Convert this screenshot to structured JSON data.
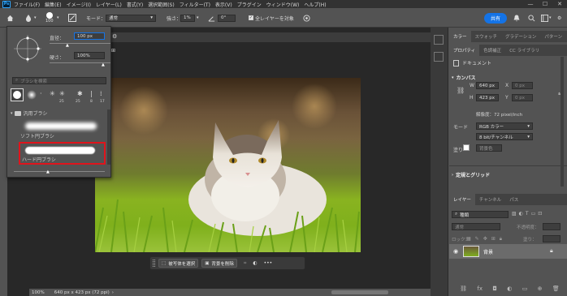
{
  "menubar": {
    "app_icon": "Ps",
    "items": [
      "ファイル(F)",
      "編集(E)",
      "イメージ(I)",
      "レイヤー(L)",
      "書式(Y)",
      "選択範囲(S)",
      "フィルター(T)",
      "表示(V)",
      "プラグイン",
      "ウィンドウ(W)",
      "ヘルプ(H)"
    ]
  },
  "options": {
    "brush_size": "100",
    "mode_label": "モード：",
    "mode_value": "通常",
    "strength_label": "強さ：",
    "strength_value": "1%",
    "angle_value": "0°",
    "all_layers_label": "全レイヤーを対象",
    "share_label": "共有"
  },
  "brush_popup": {
    "diameter_label": "直径：",
    "diameter_value": "100 px",
    "hardness_label": "硬さ：",
    "hardness_value": "100%",
    "search_placeholder": "ブラシを検索",
    "presets": [
      {
        "num": "25"
      },
      {
        "num": "25"
      },
      {
        "num": "8"
      },
      {
        "num": "17"
      }
    ],
    "folder_label": "汎用ブラシ",
    "soft_label": "ソフト円ブラシ",
    "hard_label": "ハード円ブラシ"
  },
  "context_bar": {
    "select_subject_label": "被写体を選択",
    "remove_bg_label": "背景を削除"
  },
  "status": {
    "zoom": "100%",
    "info": "640 px x 423 px (72 ppi)"
  },
  "panel_top": {
    "tabs": [
      "カラー",
      "スウォッチ",
      "グラデーション",
      "パターン"
    ],
    "tabs2": [
      "プロパティ",
      "色調補正",
      "CC ライブラリ"
    ],
    "doc_label": "ドキュメント",
    "canvas_header": "カンバス",
    "w_label": "W",
    "w_value": "640 px",
    "x_label": "X",
    "x_value": "0 px",
    "h_label": "H",
    "h_value": "423 px",
    "y_label": "Y",
    "y_value": "0 px",
    "resolution": "解像度：72 pixel/inch",
    "mode_label": "モード",
    "mode_value": "RGB カラー",
    "bit_value": "8 bit/チャンネル",
    "fill_label": "塗り",
    "fill_value": "背景色",
    "guides_header": "定規とグリッド"
  },
  "layers_panel": {
    "tabs": [
      "レイヤー",
      "チャンネル",
      "パス"
    ],
    "search_placeholder": "種類",
    "blend_mode": "通常",
    "opacity_label": "不透明度：",
    "lock_label": "ロック：",
    "fill_label": "塗り：",
    "layer_name": "背景"
  },
  "colors": {
    "accent": "#1473e6",
    "highlight_box": "#e0141c"
  }
}
